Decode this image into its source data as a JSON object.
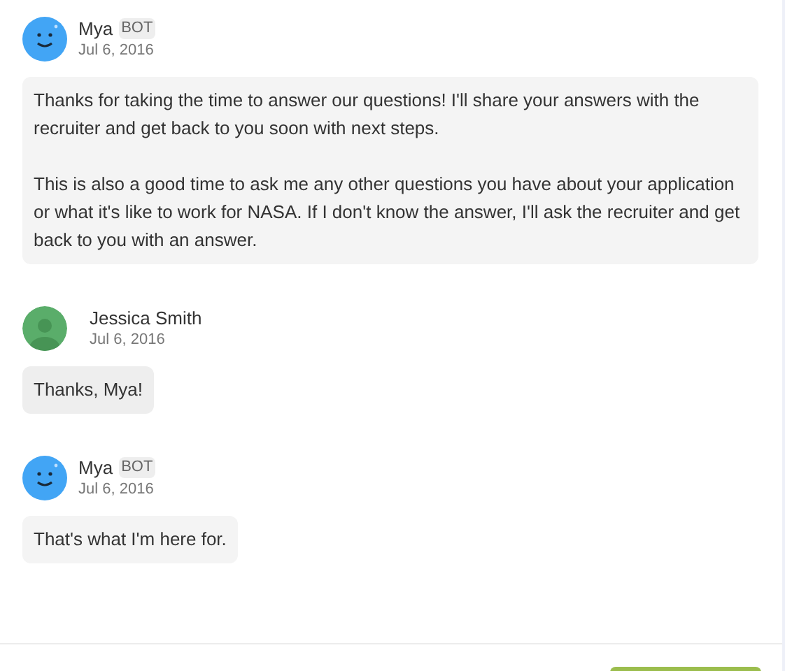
{
  "messages": [
    {
      "kind": "bot",
      "sender": "Mya",
      "badge": "BOT",
      "date": "Jul 6, 2016",
      "paragraphs": [
        "Thanks for taking the time to answer our questions! I'll share your answers with the recruiter and get back to you soon with next steps.",
        "This is also a good time to ask me any other questions you have about your application or what it's like to work for NASA. If I don't know the answer, I'll ask the recruiter and get back to you with an answer."
      ]
    },
    {
      "kind": "user",
      "sender": "Jessica Smith",
      "date": "Jul 6, 2016",
      "paragraphs": [
        "Thanks, Mya!"
      ]
    },
    {
      "kind": "bot",
      "sender": "Mya",
      "badge": "BOT",
      "date": "Jul 6, 2016",
      "paragraphs": [
        "That's what I'm here for."
      ]
    }
  ]
}
